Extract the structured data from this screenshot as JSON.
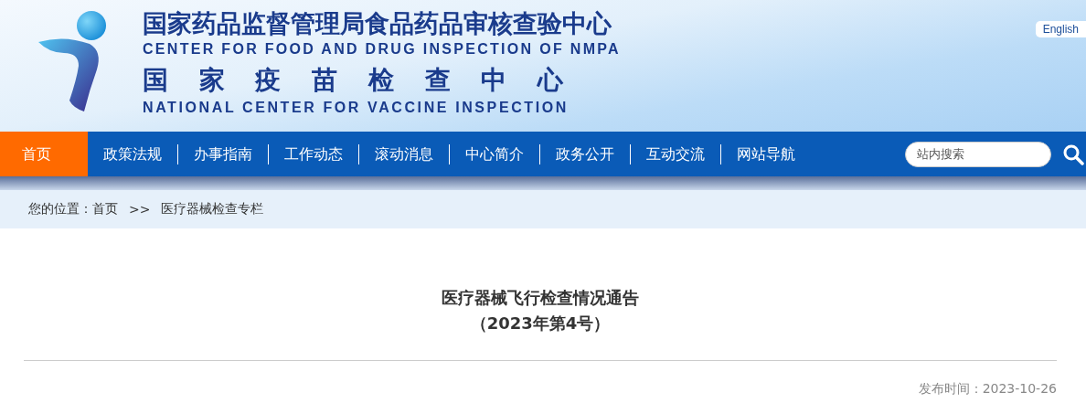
{
  "header": {
    "title_cn": "国家药品监督管理局食品药品审核查验中心",
    "title_en": "CENTER FOR FOOD AND DRUG INSPECTION OF NMPA",
    "subtitle_cn": "国 家 疫 苗 检 查 中 心",
    "subtitle_en": "NATIONAL CENTER FOR VACCINE INSPECTION",
    "language_link": "English"
  },
  "nav": [
    {
      "label": "首页",
      "selected": true
    },
    {
      "label": "政策法规",
      "selected": false
    },
    {
      "label": "办事指南",
      "selected": false
    },
    {
      "label": "工作动态",
      "selected": false
    },
    {
      "label": "滚动消息",
      "selected": false
    },
    {
      "label": "中心简介",
      "selected": false
    },
    {
      "label": "政务公开",
      "selected": false
    },
    {
      "label": "互动交流",
      "selected": false
    },
    {
      "label": "网站导航",
      "selected": false
    }
  ],
  "search": {
    "placeholder": "站内搜索"
  },
  "breadcrumb": {
    "label": "您的位置：",
    "items": [
      "首页",
      "医疗器械检查专栏"
    ],
    "separator": ">>"
  },
  "article": {
    "title": "医疗器械飞行检查情况通告",
    "subtitle": "（2023年第4号）",
    "date": "发布时间：2023-10-26"
  }
}
